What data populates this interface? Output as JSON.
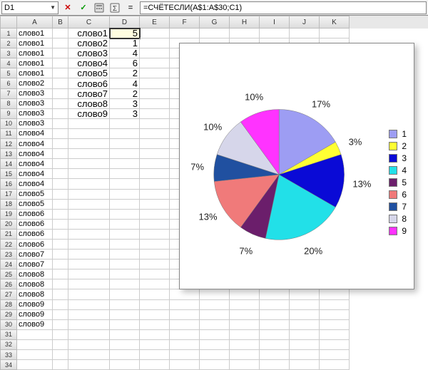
{
  "formula_bar": {
    "cell_ref": "D1",
    "formula": "=СЧЁТЕСЛИ(A$1:A$30;C1)"
  },
  "columns": {
    "labels": [
      "A",
      "B",
      "C",
      "D",
      "E",
      "F",
      "G",
      "H",
      "I",
      "J",
      "K"
    ],
    "widths": [
      50,
      22,
      58,
      42,
      42,
      42,
      42,
      42,
      42,
      42,
      42
    ]
  },
  "rows": {
    "count": 34,
    "a": [
      "слово1",
      "слово1",
      "слово1",
      "слово1",
      "слово1",
      "слово2",
      "слово3",
      "слово3",
      "слово3",
      "слово3",
      "слово4",
      "слово4",
      "слово4",
      "слово4",
      "слово4",
      "слово4",
      "слово5",
      "слово5",
      "слово6",
      "слово6",
      "слово6",
      "слово6",
      "слово7",
      "слово7",
      "слово8",
      "слово8",
      "слово8",
      "слово9",
      "слово9",
      "слово9",
      "",
      "",
      "",
      ""
    ],
    "c": [
      "слово1",
      "слово2",
      "слово3",
      "слово4",
      "слово5",
      "слово6",
      "слово7",
      "слово8",
      "слово9"
    ],
    "d": [
      "5",
      "1",
      "4",
      "6",
      "2",
      "4",
      "2",
      "3",
      "3"
    ]
  },
  "chart_data": {
    "type": "pie",
    "series": [
      {
        "name": "1",
        "value": 5,
        "pct": 17,
        "color": "#9d9df3"
      },
      {
        "name": "2",
        "value": 1,
        "pct": 3,
        "color": "#ffff33"
      },
      {
        "name": "3",
        "value": 4,
        "pct": 13,
        "color": "#0a0ad6"
      },
      {
        "name": "4",
        "value": 6,
        "pct": 20,
        "color": "#22e0e8"
      },
      {
        "name": "5",
        "value": 2,
        "pct": 7,
        "color": "#6b1e6b"
      },
      {
        "name": "6",
        "value": 4,
        "pct": 13,
        "color": "#f07a7a"
      },
      {
        "name": "7",
        "value": 2,
        "pct": 7,
        "color": "#2050a0"
      },
      {
        "name": "8",
        "value": 3,
        "pct": 10,
        "color": "#d6d6ea"
      },
      {
        "name": "9",
        "value": 3,
        "pct": 10,
        "color": "#ff33ff"
      }
    ]
  }
}
